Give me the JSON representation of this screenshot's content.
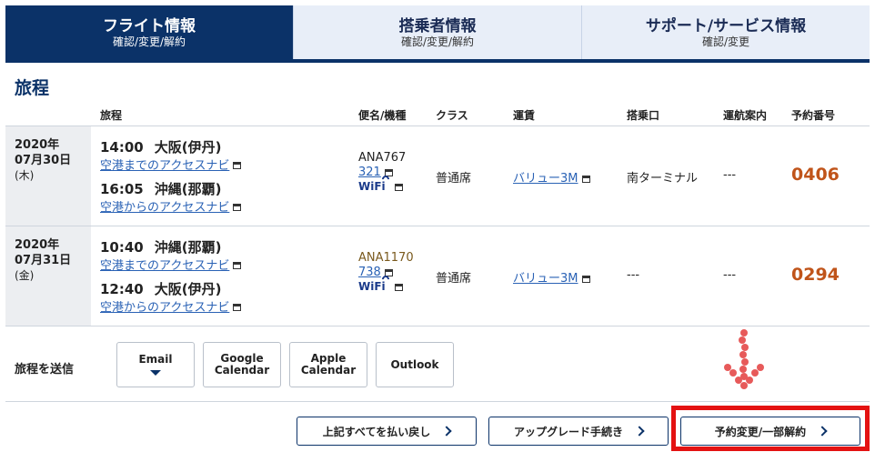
{
  "tabs": [
    {
      "title": "フライト情報",
      "sub": "確認/変更/解約"
    },
    {
      "title": "搭乗者情報",
      "sub": "確認/変更/解約"
    },
    {
      "title": "サポート/サービス情報",
      "sub": "確認/変更"
    }
  ],
  "section_title": "旅程",
  "headers": {
    "itinerary": "旅程",
    "flight": "便名/機種",
    "class": "クラス",
    "fare": "運賃",
    "gate": "搭乗口",
    "status": "運航案内",
    "resno": "予約番号"
  },
  "rows": [
    {
      "date": "2020年",
      "date2": "07月30日",
      "weekday": "(木)",
      "dep_time": "14:00",
      "dep_airport": "大阪(伊丹)",
      "dep_link": "空港までのアクセスナビ",
      "arr_time": "16:05",
      "arr_airport": "沖縄(那覇)",
      "arr_link": "空港からのアクセスナビ",
      "flight_no": "ANA767",
      "aircraft": "321",
      "wifi": "WiFi",
      "class": "普通席",
      "fare": "バリュー3M",
      "gate": "南ターミナル",
      "status": "---",
      "resno": "0406"
    },
    {
      "date": "2020年",
      "date2": "07月31日",
      "weekday": "(金)",
      "dep_time": "10:40",
      "dep_airport": "沖縄(那覇)",
      "dep_link": "空港までのアクセスナビ",
      "arr_time": "12:40",
      "arr_airport": "大阪(伊丹)",
      "arr_link": "空港からのアクセスナビ",
      "flight_no": "ANA1170",
      "aircraft": "738",
      "wifi": "WiFi",
      "class": "普通席",
      "fare": "バリュー3M",
      "gate": "---",
      "status": "---",
      "resno": "0294"
    }
  ],
  "share": {
    "label": "旅程を送信",
    "email": "Email",
    "google1": "Google",
    "google2": "Calendar",
    "apple1": "Apple",
    "apple2": "Calendar",
    "outlook": "Outlook"
  },
  "actions": {
    "refund": "上記すべてを払い戻し",
    "upgrade": "アップグレード手続き",
    "change": "予約変更/一部解約"
  },
  "colors": {
    "navy": "#0b3268",
    "highlight": "#e41212",
    "resno": "#c0541a",
    "link": "#2a62b5"
  }
}
